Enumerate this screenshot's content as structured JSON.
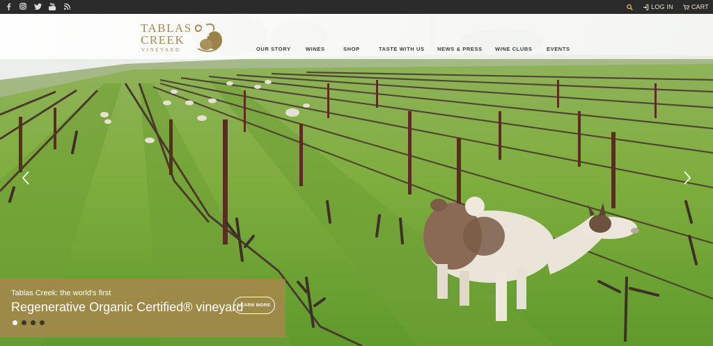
{
  "topbar": {
    "social_icons": [
      "facebook-icon",
      "instagram-icon",
      "twitter-icon",
      "youtube-icon",
      "rss-icon"
    ],
    "login_label": "LOG IN",
    "cart_label": "CART",
    "accent_color": "#f1e6cc"
  },
  "logo": {
    "line1": "TABLAS",
    "line2": "CREEK",
    "line3": "VINEYARD",
    "color": "#a08a55"
  },
  "nav": {
    "items": [
      "OUR STORY",
      "WINES",
      "SHOP",
      "TASTE WITH US",
      "NEWS & PRESS",
      "WINE CLUBS",
      "EVENTS"
    ]
  },
  "slide": {
    "subtitle": "Tablas Creek: the world's first",
    "title": "Regenerative Organic Certified® vineyard",
    "button_label": "LEARN MORE",
    "slide_count": 4,
    "active_slide": 1,
    "box_color": "#a5874b"
  }
}
